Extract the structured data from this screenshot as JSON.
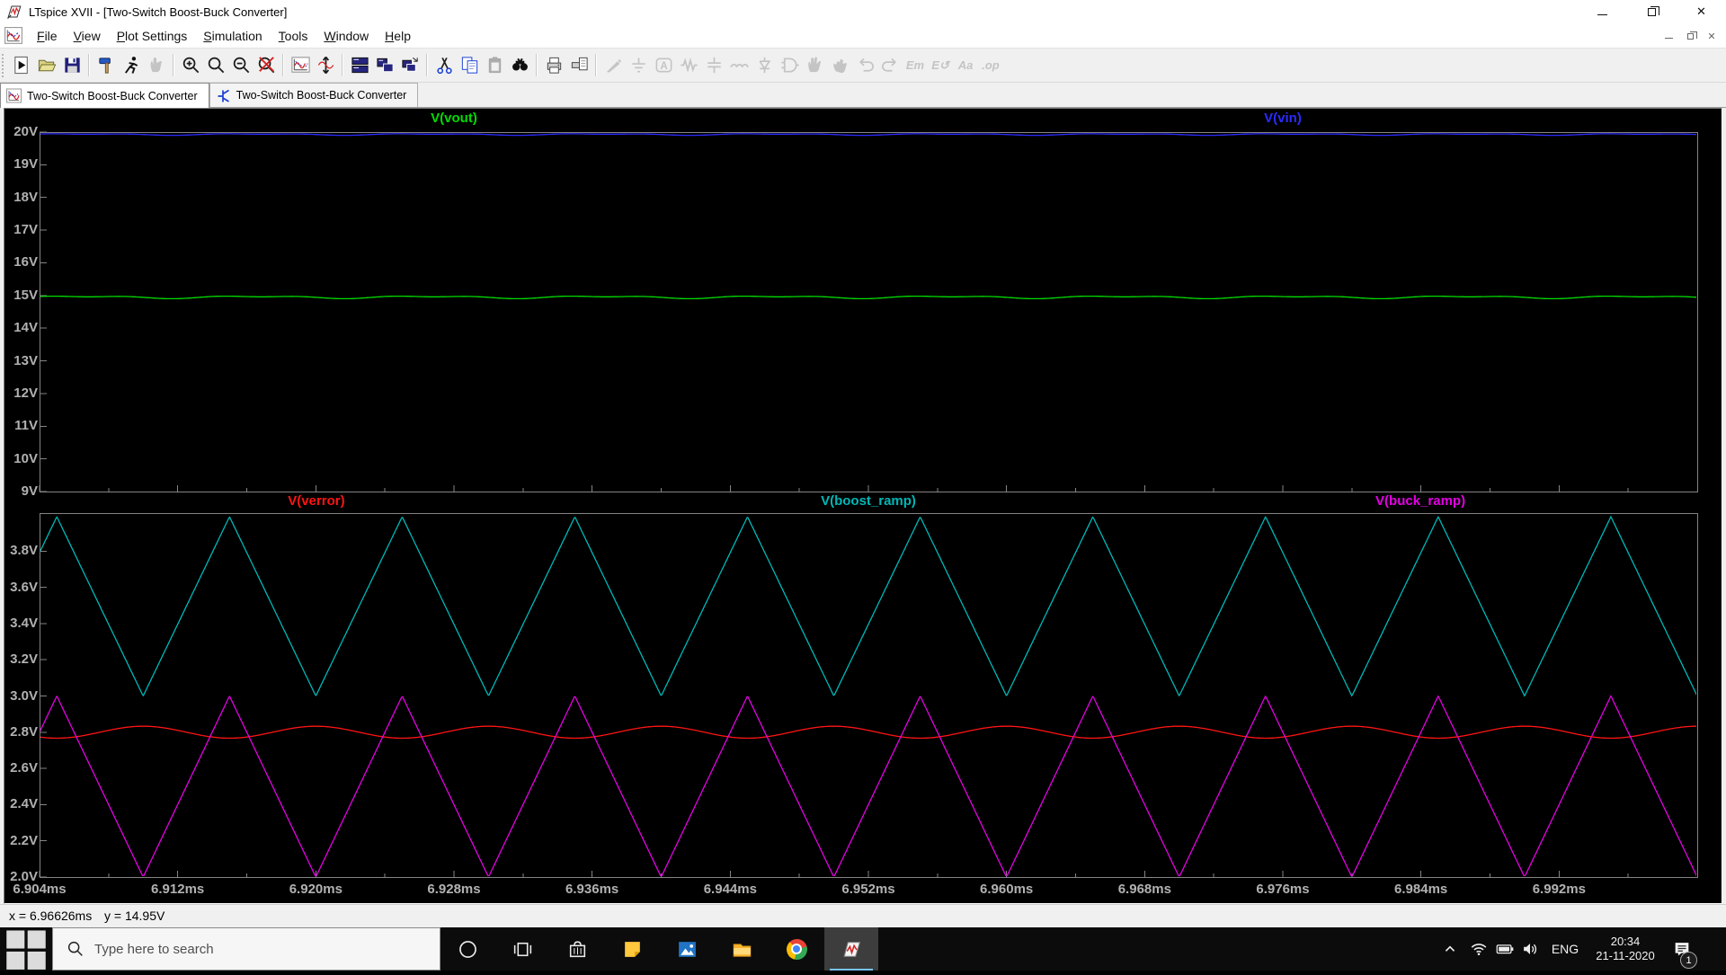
{
  "window": {
    "title": "LTspice XVII - [Two-Switch Boost-Buck Converter]",
    "caption_buttons": [
      "minimize",
      "restore",
      "close"
    ]
  },
  "menu": {
    "items": [
      "File",
      "View",
      "Plot Settings",
      "Simulation",
      "Tools",
      "Window",
      "Help"
    ]
  },
  "toolbar": {
    "items": [
      {
        "icon": "run",
        "name": "run-button",
        "enabled": true
      },
      {
        "icon": "open",
        "name": "open-button",
        "enabled": true
      },
      {
        "icon": "save",
        "name": "save-button",
        "enabled": true
      },
      {
        "sep": true
      },
      {
        "icon": "hammer",
        "name": "control-panel-button",
        "enabled": true
      },
      {
        "icon": "runner",
        "name": "run-simulation-button",
        "enabled": true
      },
      {
        "icon": "halt",
        "name": "halt-button",
        "enabled": false
      },
      {
        "sep": true
      },
      {
        "icon": "zoom-in",
        "name": "zoom-in-button",
        "enabled": true
      },
      {
        "icon": "zoom-back",
        "name": "zoom-back-button",
        "enabled": true
      },
      {
        "icon": "zoom-out",
        "name": "zoom-out-button",
        "enabled": true
      },
      {
        "icon": "zoom-full",
        "name": "zoom-full-extents-button",
        "enabled": true
      },
      {
        "sep": true
      },
      {
        "icon": "autorange",
        "name": "autorange-button",
        "enabled": true
      },
      {
        "icon": "fit",
        "name": "fit-axes-button",
        "enabled": true
      },
      {
        "sep": true
      },
      {
        "icon": "tile-vert",
        "name": "tile-vertically-button",
        "enabled": true
      },
      {
        "icon": "tile-horiz",
        "name": "tile-horizontally-button",
        "enabled": true
      },
      {
        "icon": "cascade",
        "name": "cascade-windows-button",
        "enabled": true
      },
      {
        "sep": true
      },
      {
        "icon": "cut",
        "name": "cut-button",
        "enabled": true
      },
      {
        "icon": "copy",
        "name": "copy-button",
        "enabled": true
      },
      {
        "icon": "paste",
        "name": "paste-button",
        "enabled": false
      },
      {
        "icon": "find",
        "name": "find-button",
        "enabled": true
      },
      {
        "sep": true
      },
      {
        "icon": "print",
        "name": "print-button",
        "enabled": true
      },
      {
        "icon": "preview",
        "name": "print-preview-button",
        "enabled": true
      },
      {
        "sep": true
      },
      {
        "icon": "wire",
        "name": "draw-wire-button",
        "enabled": false
      },
      {
        "icon": "ground",
        "name": "ground-button",
        "enabled": false
      },
      {
        "icon": "label",
        "name": "label-net-button",
        "enabled": false
      },
      {
        "icon": "resistor",
        "name": "resistor-button",
        "enabled": false
      },
      {
        "icon": "capacitor",
        "name": "capacitor-button",
        "enabled": false
      },
      {
        "icon": "inductor",
        "name": "inductor-button",
        "enabled": false
      },
      {
        "icon": "diode",
        "name": "diode-button",
        "enabled": false
      },
      {
        "icon": "component",
        "name": "component-button",
        "enabled": false
      },
      {
        "icon": "move",
        "name": "move-button",
        "enabled": false
      },
      {
        "icon": "drag",
        "name": "drag-button",
        "enabled": false
      },
      {
        "icon": "undo",
        "name": "undo-button",
        "enabled": false
      },
      {
        "icon": "redo",
        "name": "redo-button",
        "enabled": false
      },
      {
        "icon": "mirror",
        "name": "mirror-button",
        "enabled": false,
        "text": "Em"
      },
      {
        "icon": "rotate",
        "name": "rotate-button",
        "enabled": false,
        "text": "E↺"
      },
      {
        "icon": "text",
        "name": "text-button",
        "enabled": false,
        "text": "Aa"
      },
      {
        "icon": "op",
        "name": "spice-directive-button",
        "enabled": false,
        "text": ".op"
      }
    ]
  },
  "tabs": [
    {
      "label": "Two-Switch Boost-Buck Converter",
      "icon": "waveform",
      "active": true
    },
    {
      "label": "Two-Switch Boost-Buck Converter",
      "icon": "schematic",
      "active": false
    }
  ],
  "chart_data": [
    {
      "type": "line",
      "pane": "top",
      "ylim": [
        9,
        20
      ],
      "y_ticks": [
        "20V",
        "19V",
        "18V",
        "17V",
        "16V",
        "15V",
        "14V",
        "13V",
        "12V",
        "11V",
        "10V",
        "9V"
      ],
      "y_tick_values": [
        20,
        19,
        18,
        17,
        16,
        15,
        14,
        13,
        12,
        11,
        10,
        9
      ],
      "x_range_ms": [
        6.904,
        7.0
      ],
      "grid": false,
      "series": [
        {
          "name": "V(vout)",
          "color": "#00dc00",
          "kind": "flat_ripple",
          "level_V": 14.95,
          "ripple_V": 0.05,
          "period_us": 10,
          "label_pos": 0.25
        },
        {
          "name": "V(vin)",
          "color": "#2b2bff",
          "kind": "flat_ripple",
          "level_V": 19.93,
          "ripple_V": 0.03,
          "period_us": 10,
          "label_pos": 0.75
        }
      ]
    },
    {
      "type": "line",
      "pane": "bottom",
      "ylim": [
        2.0,
        4.01
      ],
      "y_ticks": [
        "3.8V",
        "3.6V",
        "3.4V",
        "3.2V",
        "3.0V",
        "2.8V",
        "2.6V",
        "2.4V",
        "2.2V",
        "2.0V"
      ],
      "y_tick_values": [
        3.8,
        3.6,
        3.4,
        3.2,
        3.0,
        2.8,
        2.6,
        2.4,
        2.2,
        2.0
      ],
      "x_ticks": [
        "6.904ms",
        "6.912ms",
        "6.920ms",
        "6.928ms",
        "6.936ms",
        "6.944ms",
        "6.952ms",
        "6.960ms",
        "6.968ms",
        "6.976ms",
        "6.984ms",
        "6.992ms"
      ],
      "x_tick_values_ms": [
        6.904,
        6.912,
        6.92,
        6.928,
        6.936,
        6.944,
        6.952,
        6.96,
        6.968,
        6.976,
        6.984,
        6.992
      ],
      "x_minor_step_ms": 0.004,
      "x_range_ms": [
        6.904,
        7.0
      ],
      "grid": false,
      "series": [
        {
          "name": "V(verror)",
          "color": "#ff1414",
          "kind": "error_wave",
          "mean_V": 2.8,
          "amp_V": 0.033,
          "period_us": 10,
          "dip_at_ms": 6.905,
          "label_pos": 0.167
        },
        {
          "name": "V(boost_ramp)",
          "color": "#00b7b7",
          "kind": "triangle",
          "min_V": 3.0,
          "max_V": 3.99,
          "period_us": 10,
          "valley_at_ms": 6.91,
          "label_pos": 0.5
        },
        {
          "name": "V(buck_ramp)",
          "color": "#e400e4",
          "kind": "triangle",
          "min_V": 2.0,
          "max_V": 3.0,
          "period_us": 10,
          "valley_at_ms": 6.91,
          "label_pos": 0.833
        }
      ]
    }
  ],
  "status": {
    "x_readout": "x = 6.96626ms",
    "y_readout": "y = 14.95V"
  },
  "taskbar": {
    "search_placeholder": "Type here to search",
    "apps": [
      {
        "name": "cortana",
        "active": false
      },
      {
        "name": "task-view",
        "active": false
      },
      {
        "name": "store",
        "active": false
      },
      {
        "name": "sticky-notes",
        "active": false
      },
      {
        "name": "photos",
        "active": false
      },
      {
        "name": "file-explorer",
        "active": false
      },
      {
        "name": "chrome",
        "active": false
      },
      {
        "name": "ltspice",
        "active": true
      }
    ],
    "tray": {
      "language": "ENG",
      "time": "20:34",
      "date": "21-11-2020",
      "notification_count": "1"
    }
  }
}
